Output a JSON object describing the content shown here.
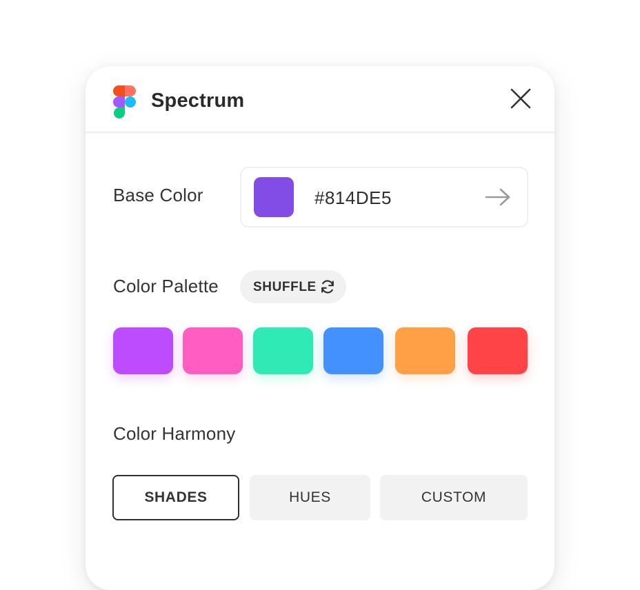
{
  "app": {
    "title": "Spectrum",
    "logo_icon": "figma-logo-icon",
    "close_icon": "close-icon"
  },
  "base_color": {
    "label": "Base Color",
    "value": "#814DE5",
    "swatch_color": "#814DE5",
    "submit_icon": "arrow-right-icon"
  },
  "palette": {
    "label": "Color Palette",
    "shuffle_label": "SHUFFLE",
    "shuffle_icon": "refresh-icon",
    "swatches": [
      {
        "color": "#BD4BFF"
      },
      {
        "color": "#FF5DC1"
      },
      {
        "color": "#2FEAB5"
      },
      {
        "color": "#4390FF"
      },
      {
        "color": "#FFA046"
      },
      {
        "color": "#FF4448"
      }
    ]
  },
  "harmony": {
    "label": "Color Harmony",
    "options": [
      {
        "label": "SHADES",
        "active": true
      },
      {
        "label": "HUES",
        "active": false
      },
      {
        "label": "CUSTOM",
        "active": false
      }
    ]
  }
}
